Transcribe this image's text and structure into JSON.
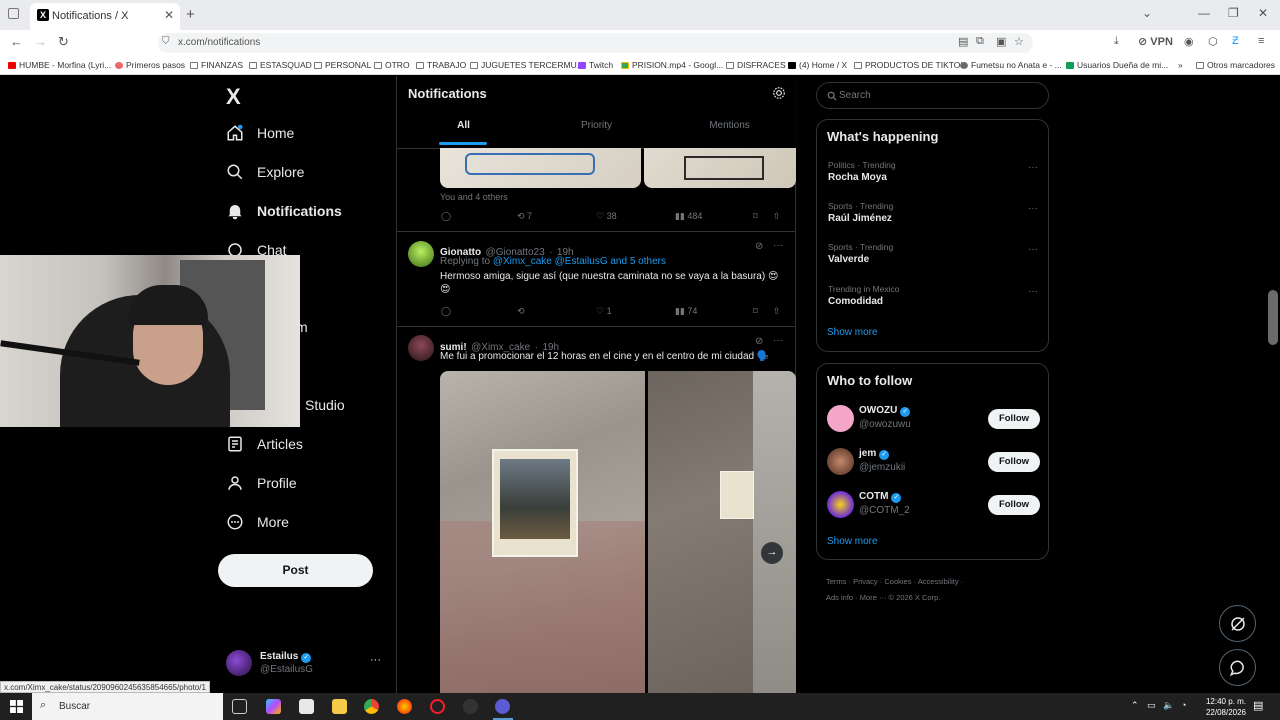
{
  "browser": {
    "tab_title": "Notifications / X",
    "url": "x.com/notifications",
    "vpn_label": "VPN",
    "bookmarks": [
      "HUMBE - Morfina (Lyri...",
      "Primeros pasos",
      "FINANZAS",
      "ESTASQUAD",
      "PERSONAL",
      "OTRO",
      "TRABAJO",
      "JUGUETES TERCERMU...",
      "Twitch",
      "PRISION.mp4 - Googl...",
      "DISFRACES",
      "(4) Home / X",
      "PRODUCTOS DE TIKTOK",
      "Fumetsu no Anata e - ...",
      "Usuarios Dueña de mi..."
    ],
    "other_bookmarks": "Otros marcadores",
    "status_url": "x.com/Ximx_cake/status/2090960245635854665/photo/1"
  },
  "sidebar": {
    "logo": "X",
    "items": [
      {
        "label": "Home",
        "icon": "home-icon"
      },
      {
        "label": "Explore",
        "icon": "search-icon"
      },
      {
        "label": "Notifications",
        "icon": "bell-icon"
      },
      {
        "label": "Chat",
        "icon": "chat-icon"
      },
      {
        "label": "Studio",
        "icon": "studio-icon"
      },
      {
        "label": "Articles",
        "icon": "articles-icon"
      },
      {
        "label": "Profile",
        "icon": "person-icon"
      },
      {
        "label": "More",
        "icon": "more-circle-icon"
      }
    ],
    "partial_label": "m",
    "post_label": "Post",
    "account": {
      "name": "Estailus",
      "handle": "@EstailusG"
    }
  },
  "notifications": {
    "title": "Notifications",
    "tabs": [
      "All",
      "Priority",
      "Mentions"
    ],
    "active_tab": "All",
    "liked_summary": "You and 4 others",
    "first_stats": {
      "retweets": "7",
      "likes": "38",
      "views": "484"
    },
    "tweet1": {
      "name": "Gionatto",
      "handle": "@Gionatto23",
      "time": "19h",
      "replying_prefix": "Replying to",
      "replying_to": "@Ximx_cake @EstailusG and 5 others",
      "text": "Hermoso amiga, sigue así (que nuestra caminata no se vaya a la basura) 😍 😍",
      "likes": "1",
      "views": "74"
    },
    "tweet2": {
      "name": "sumi!",
      "handle": "@Ximx_cake",
      "time": "19h",
      "text": "Me fui a promocionar el 12 horas en el cine y en el centro de mi ciudad 🗣️"
    }
  },
  "right": {
    "search_placeholder": "Search",
    "happening_title": "What's happening",
    "trends": [
      {
        "category": "Politics · Trending",
        "name": "Rocha Moya"
      },
      {
        "category": "Sports · Trending",
        "name": "Raúl Jiménez"
      },
      {
        "category": "Sports · Trending",
        "name": "Valverde"
      },
      {
        "category": "Trending in Mexico",
        "name": "Comodidad"
      }
    ],
    "show_more": "Show more",
    "follow_title": "Who to follow",
    "suggestions": [
      {
        "name": "OWOZU",
        "handle": "@owozuwu"
      },
      {
        "name": "jem",
        "handle": "@jemzukii"
      },
      {
        "name": "COTM",
        "handle": "@COTM_2"
      }
    ],
    "follow_label": "Follow",
    "footer": [
      "Terms",
      "Privacy",
      "Cookies",
      "Accessibility",
      "Ads info",
      "More ···",
      "© 2026 X Corp."
    ]
  },
  "taskbar": {
    "search_label": "Buscar",
    "time": "12:40 p. m.",
    "date": "22/08/2026"
  },
  "colors": {
    "accent": "#1d9bf0",
    "background": "#000000",
    "border": "#2f3336",
    "muted": "#71767b"
  }
}
